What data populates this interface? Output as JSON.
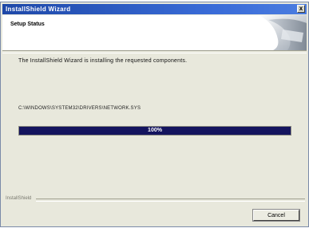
{
  "window": {
    "title": "InstallShield Wizard",
    "close_glyph": "x"
  },
  "header": {
    "title": "Setup Status"
  },
  "body": {
    "status_message": "The InstallShield Wizard is installing the requested components.",
    "progress_label": "C:\\WINDOWS\\SYSTEM32\\DRIVERS\\NETWORK.SYS",
    "progress_percent": 100,
    "progress_text": "100%"
  },
  "footer": {
    "brand": "InstallShield",
    "cancel_label": "Cancel"
  },
  "colors": {
    "titlebar": "#1e48a8",
    "progress_fill": "#14145e",
    "window_bg": "#e8e8dc"
  }
}
